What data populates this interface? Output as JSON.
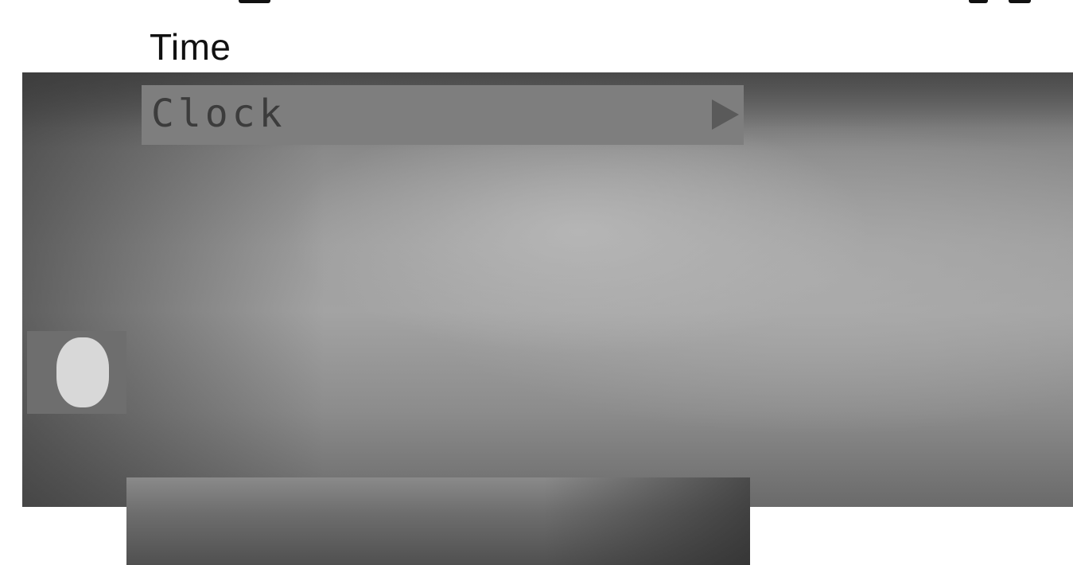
{
  "header": {
    "title": "Time"
  },
  "menu": {
    "items": [
      {
        "label": "Clock",
        "selected": true,
        "icon": "chevron-right-icon"
      }
    ]
  },
  "side_tab": {
    "icon": "clock-tab-icon"
  },
  "colors": {
    "highlight_bar": "#7e7e7e",
    "label_text": "#3c3c3c",
    "side_tab": "#6e6e6e",
    "side_tab_icon": "#d8d8d8"
  }
}
